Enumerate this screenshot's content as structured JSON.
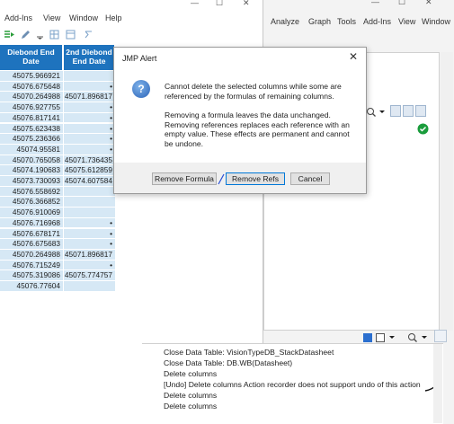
{
  "left_window": {
    "menu": [
      "Add-Ins",
      "View",
      "Window",
      "Help"
    ],
    "table": {
      "headers": [
        "Diebond End Date",
        "2nd Diebond End Date"
      ],
      "rows": [
        [
          "45075.966921",
          ""
        ],
        [
          "45076.675648",
          "•"
        ],
        [
          "45070.264988",
          "45071.896817"
        ],
        [
          "45076.927755",
          "•"
        ],
        [
          "45076.817141",
          "•"
        ],
        [
          "45075.623438",
          "•"
        ],
        [
          "45075.236366",
          "•"
        ],
        [
          "45074.95581",
          "•"
        ],
        [
          "45070.765058",
          "45071.736435"
        ],
        [
          "45074.190683",
          "45075.612859"
        ],
        [
          "45073.730093",
          "45074.607584"
        ],
        [
          "45076.558692",
          ""
        ],
        [
          "45076.366852",
          ""
        ],
        [
          "45076.910069",
          ""
        ],
        [
          "45076.716968",
          "•"
        ],
        [
          "45076.678171",
          "•"
        ],
        [
          "45076.675683",
          "•"
        ],
        [
          "45070.264988",
          "45071.896817"
        ],
        [
          "45076.715249",
          "•"
        ],
        [
          "45075.319086",
          "45075.774757"
        ],
        [
          "45076.77604",
          ""
        ]
      ]
    }
  },
  "right_window": {
    "menu": [
      "Analyze",
      "Graph",
      "Tools",
      "Add-Ins",
      "View",
      "Window"
    ],
    "log_lines": [
      "Close Data Table: VisionTypeDB_StackDatasheet",
      "Close Data Table: DB.WB(Datasheet)",
      "Delete columns",
      "[Undo] Delete columns Action recorder does not support undo of this action",
      "Delete columns",
      "Delete columns"
    ]
  },
  "dialog": {
    "title": "JMP Alert",
    "message_1": "Cannot delete the selected columns while some are referenced by the formulas of remaining columns.",
    "message_2": "Removing a formula leaves the data unchanged. Removing references replaces each reference with an empty value. These effects are permanent and cannot be undone.",
    "buttons": {
      "remove_formula": "Remove Formula",
      "remove_refs": "Remove Refs",
      "cancel": "Cancel"
    }
  },
  "colors": {
    "header_blue": "#1e73be",
    "cell_blue": "#d6e8f5",
    "green_check": "#1a9c3c"
  }
}
